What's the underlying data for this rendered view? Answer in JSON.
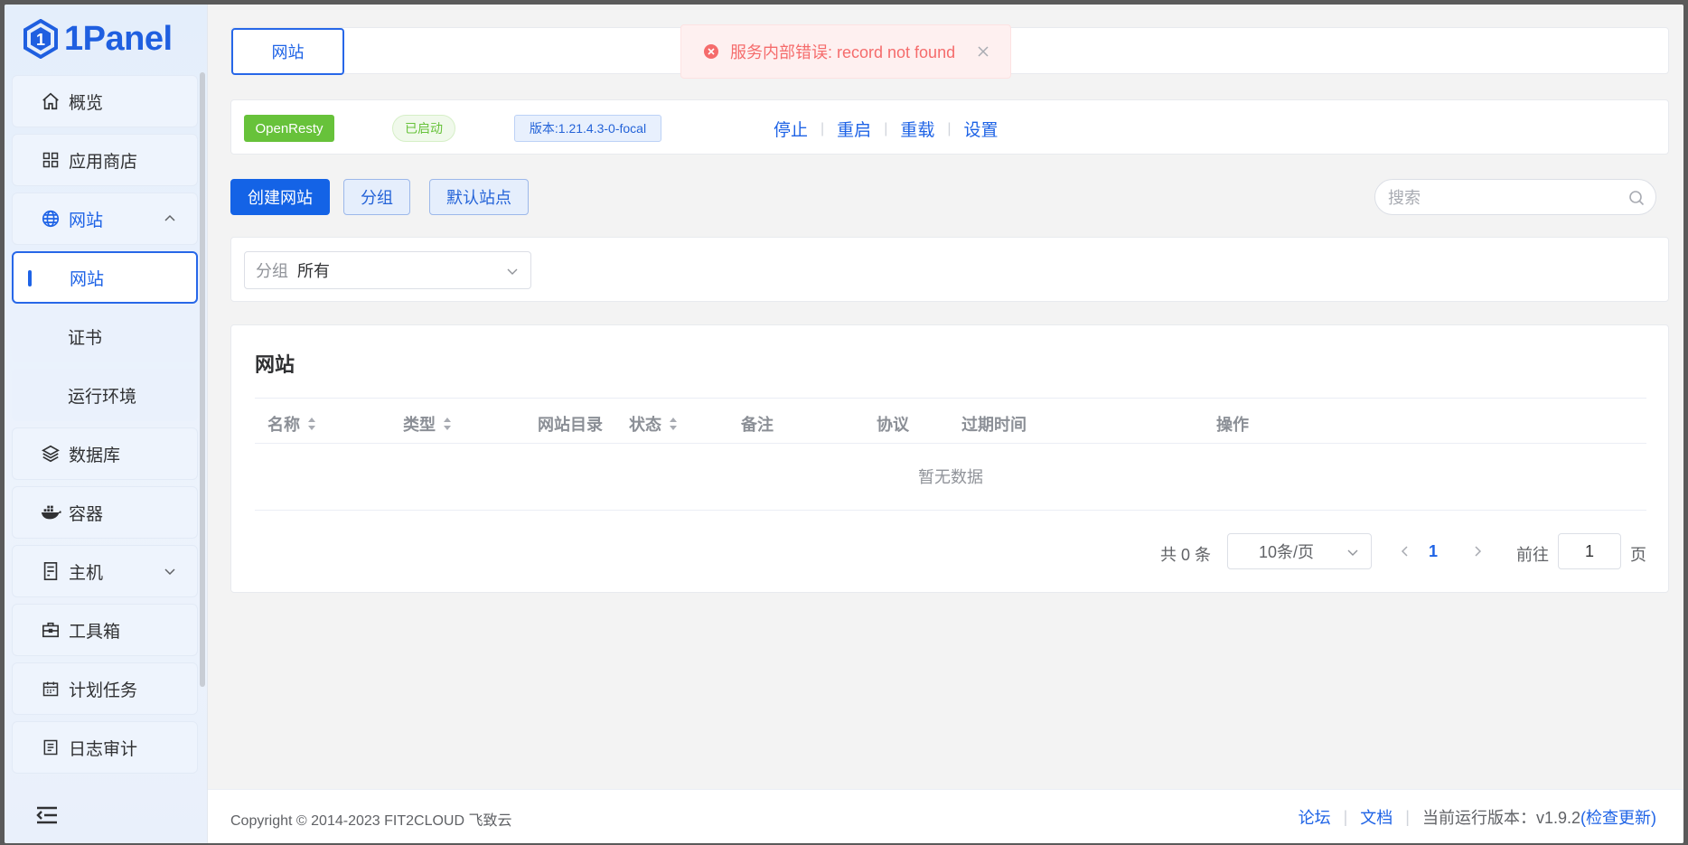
{
  "brand": {
    "name": "1Panel",
    "color": "#1f5fe0"
  },
  "sidebar": {
    "items": [
      {
        "label": "概览",
        "icon": "home-icon"
      },
      {
        "label": "应用商店",
        "icon": "grid-icon"
      },
      {
        "label": "网站",
        "icon": "globe-icon",
        "expanded": true,
        "children": [
          {
            "label": "网站",
            "active": true
          },
          {
            "label": "证书"
          },
          {
            "label": "运行环境"
          }
        ]
      },
      {
        "label": "数据库",
        "icon": "layers-icon"
      },
      {
        "label": "容器",
        "icon": "docker-icon"
      },
      {
        "label": "主机",
        "icon": "server-icon",
        "expandable": true
      },
      {
        "label": "工具箱",
        "icon": "toolbox-icon"
      },
      {
        "label": "计划任务",
        "icon": "calendar-icon"
      },
      {
        "label": "日志审计",
        "icon": "log-icon"
      }
    ]
  },
  "tabs": [
    {
      "label": "网站",
      "active": true
    }
  ],
  "toast": {
    "type": "error",
    "message": "服务内部错误: record not found"
  },
  "app": {
    "name": "OpenResty",
    "status": "已启动",
    "version": "版本:1.21.4.3-0-focal",
    "actions": [
      "停止",
      "重启",
      "重载",
      "设置"
    ]
  },
  "toolbar": {
    "create_label": "创建网站",
    "group_label": "分组",
    "default_site_label": "默认站点",
    "search_placeholder": "搜索"
  },
  "filter": {
    "label": "分组",
    "value": "所有"
  },
  "table": {
    "title": "网站",
    "columns": [
      {
        "label": "名称",
        "sortable": true
      },
      {
        "label": "类型",
        "sortable": true
      },
      {
        "label": "网站目录",
        "sortable": false
      },
      {
        "label": "状态",
        "sortable": true
      },
      {
        "label": "备注",
        "sortable": false
      },
      {
        "label": "协议",
        "sortable": false
      },
      {
        "label": "过期时间",
        "sortable": false
      },
      {
        "label": "操作",
        "sortable": false
      }
    ],
    "rows": [],
    "empty_text": "暂无数据"
  },
  "pagination": {
    "total_text": "共 0 条",
    "page_size": "10条/页",
    "current_page": "1",
    "goto_label": "前往",
    "goto_value": "1",
    "page_unit": "页"
  },
  "footer": {
    "copyright": "Copyright © 2014-2023 FIT2CLOUD 飞致云",
    "forum": "论坛",
    "docs": "文档",
    "version_text": "当前运行版本：v1.9.2",
    "check_update": "(检查更新)"
  },
  "colors": {
    "primary": "#1463e6",
    "success": "#67c23a",
    "danger": "#f56c6c"
  }
}
